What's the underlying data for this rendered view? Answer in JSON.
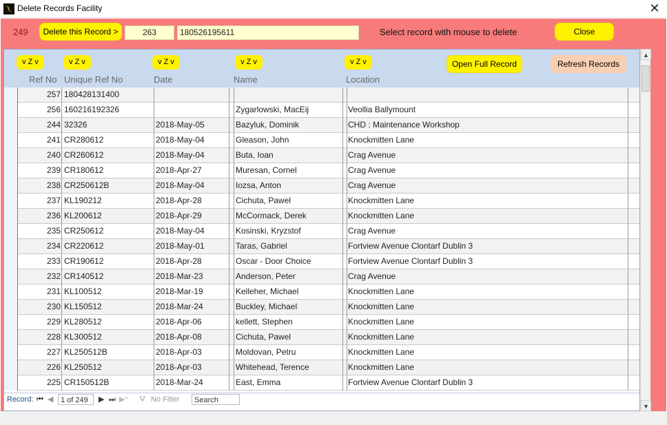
{
  "window": {
    "title": "Delete Records Facility",
    "close_glyph": "✕",
    "icon": "app-bolt-icon"
  },
  "header": {
    "current_ref": "249",
    "delete_label": "Delete this Record >",
    "selected_ref": "263",
    "selected_unique": "180526195611",
    "instruction": "Select record with mouse to delete",
    "close_label": "Close"
  },
  "columns": {
    "sort_label": "v Z v",
    "ref_no": "Ref No",
    "unique_ref": "Unique Ref No",
    "date": "Date",
    "name": "Name",
    "location": "Location"
  },
  "buttons": {
    "open_full": "Open Full Record",
    "refresh": "Refresh Records"
  },
  "rows": [
    {
      "ref": "257",
      "unique": "180428131400",
      "date": "",
      "name": "",
      "location": ""
    },
    {
      "ref": "256",
      "unique": "160216192326",
      "date": "",
      "name": "Zygarlowski, MacEij",
      "location": "Veollia Ballymount"
    },
    {
      "ref": "244",
      "unique": "32326",
      "date": "2018-May-05",
      "name": "Bazyluk, Dominik",
      "location": "CHD : Maintenance Workshop"
    },
    {
      "ref": "241",
      "unique": "CR280612",
      "date": "2018-May-04",
      "name": "Gleason, John",
      "location": "Knockmitten Lane"
    },
    {
      "ref": "240",
      "unique": "CR260612",
      "date": "2018-May-04",
      "name": "Buta, Ioan",
      "location": "Crag Avenue"
    },
    {
      "ref": "239",
      "unique": "CR180612",
      "date": "2018-Apr-27",
      "name": "Muresan, Cornel",
      "location": "Crag Avenue"
    },
    {
      "ref": "238",
      "unique": "CR250612B",
      "date": "2018-May-04",
      "name": "Iozsa, Anton",
      "location": "Crag Avenue"
    },
    {
      "ref": "237",
      "unique": "KL190212",
      "date": "2018-Apr-28",
      "name": "Cichuta, Pawel",
      "location": "Knockmitten Lane"
    },
    {
      "ref": "236",
      "unique": "KL200612",
      "date": "2018-Apr-29",
      "name": "McCormack, Derek",
      "location": "Knockmitten Lane"
    },
    {
      "ref": "235",
      "unique": "CR250612",
      "date": "2018-May-04",
      "name": "Kosinski, Kryzstof",
      "location": "Crag Avenue"
    },
    {
      "ref": "234",
      "unique": "CR220612",
      "date": "2018-May-01",
      "name": "Taras, Gabriel",
      "location": "Fortview Avenue Clontarf Dublin 3"
    },
    {
      "ref": "233",
      "unique": "CR190612",
      "date": "2018-Apr-28",
      "name": "Oscar - Door Choice",
      "location": "Fortview Avenue Clontarf Dublin 3"
    },
    {
      "ref": "232",
      "unique": "CR140512",
      "date": "2018-Mar-23",
      "name": "Anderson, Peter",
      "location": "Crag Avenue"
    },
    {
      "ref": "231",
      "unique": "KL100512",
      "date": "2018-Mar-19",
      "name": "Kelleher, Michael",
      "location": "Knockmitten Lane"
    },
    {
      "ref": "230",
      "unique": "KL150512",
      "date": "2018-Mar-24",
      "name": "Buckley, Michael",
      "location": "Knockmitten Lane"
    },
    {
      "ref": "229",
      "unique": "KL280512",
      "date": "2018-Apr-06",
      "name": "kellett, Stephen",
      "location": "Knockmitten Lane"
    },
    {
      "ref": "228",
      "unique": "KL300512",
      "date": "2018-Apr-08",
      "name": "Cichuta, Pawel",
      "location": "Knockmitten Lane"
    },
    {
      "ref": "227",
      "unique": "KL250512B",
      "date": "2018-Apr-03",
      "name": "Moldovan, Petru",
      "location": "Knockmitten Lane"
    },
    {
      "ref": "226",
      "unique": "KL250512",
      "date": "2018-Apr-03",
      "name": "Whitehead, Terence",
      "location": "Knockmitten Lane"
    },
    {
      "ref": "225",
      "unique": "CR150512B",
      "date": "2018-Mar-24",
      "name": "East, Emma",
      "location": "Fortview Avenue Clontarf Dublin 3"
    }
  ],
  "navigation": {
    "record_label": "Record:",
    "position": "1 of 249",
    "filter_label": "No Filter",
    "search_placeholder": "Search"
  }
}
